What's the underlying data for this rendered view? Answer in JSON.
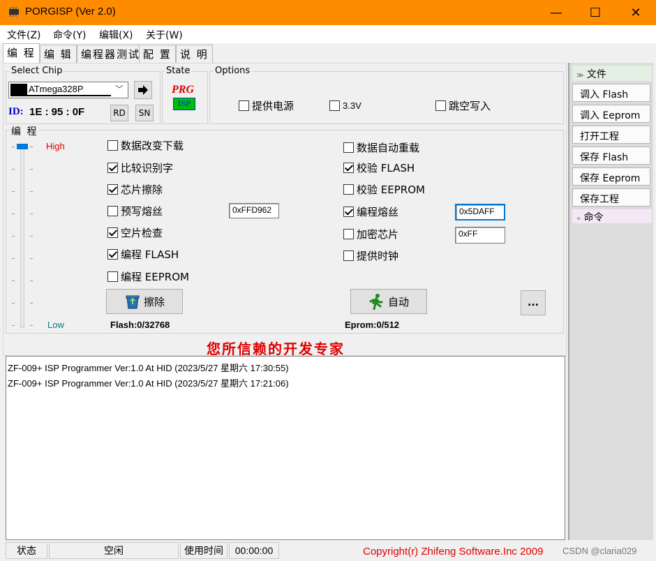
{
  "window": {
    "title": "PORGISP (Ver 2.0)",
    "minimize": "—",
    "maximize": "☐",
    "close": "✕"
  },
  "menu": [
    "文件(Z)",
    "命令(Y)",
    "编辑(X)",
    "关于(W)"
  ],
  "tabs": [
    "编 程",
    "编 辑",
    "编程器测试",
    "配 置",
    "说 明"
  ],
  "select_chip": {
    "label": "Select Chip",
    "chip": "ATmega328P",
    "id_label": "ID:",
    "id_value": "1E : 95 : 0F",
    "rd": "RD",
    "sn": "SN"
  },
  "state": {
    "label": "State",
    "logo_top": "PRG",
    "logo_bottom": "ISP"
  },
  "options": {
    "label": "Options",
    "items": [
      {
        "label": "提供电源",
        "checked": false
      },
      {
        "label": "3.3V",
        "checked": false
      },
      {
        "label": "跳空写入",
        "checked": false
      }
    ]
  },
  "program": {
    "label": "编 程",
    "slider_high": "High",
    "slider_low": "Low",
    "slider_level": 1.0,
    "left_checks": [
      {
        "label": "数据改变下载",
        "checked": false
      },
      {
        "label": "比较识别字",
        "checked": true
      },
      {
        "label": "芯片擦除",
        "checked": true
      },
      {
        "label": "预写熔丝",
        "checked": false
      },
      {
        "label": "空片检查",
        "checked": true
      },
      {
        "label": "编程 FLASH",
        "checked": true
      },
      {
        "label": "编程 EEPROM",
        "checked": false
      }
    ],
    "right_checks": [
      {
        "label": "数据自动重载",
        "checked": false
      },
      {
        "label": "校验 FLASH",
        "checked": true
      },
      {
        "label": "校验 EEPROM",
        "checked": false
      },
      {
        "label": "编程熔丝",
        "checked": true
      },
      {
        "label": "加密芯片",
        "checked": false
      },
      {
        "label": "提供时钟",
        "checked": false
      }
    ],
    "prewrite_fuse_value": "0xFFD962",
    "fuse_value": "0x5DAFF",
    "lock_value": "0xFF",
    "erase_button": "擦除",
    "auto_button": "自动",
    "more_button": "...",
    "flash_info": "Flash:0/32768",
    "eprom_info": "Eprom:0/512"
  },
  "slogan": "您所信赖的开发专家",
  "log_lines": [
    "ZF-009+ ISP Programmer Ver:1.0 At HID (2023/5/27 星期六 17:30:55)",
    "ZF-009+ ISP Programmer Ver:1.0 At HID (2023/5/27 星期六 17:21:06)"
  ],
  "right_panel": {
    "file_header": "文件",
    "buttons": [
      "调入 Flash",
      "调入 Eeprom",
      "打开工程",
      "保存 Flash",
      "保存 Eeprom",
      "保存工程"
    ],
    "cmd_header": "命令"
  },
  "status": {
    "state_label": "状态",
    "state_value": "空闲",
    "time_label": "使用时间",
    "time_value": "00:00:00",
    "copyright": "Copyright(r) Zhifeng Software.Inc 2009",
    "watermark": "CSDN @claria029"
  },
  "colors": {
    "titlebar": "#ff8c00",
    "slogan": "#e00000",
    "high_label": "#e00000",
    "low_label": "#008080",
    "id_label": "#0000cc"
  }
}
